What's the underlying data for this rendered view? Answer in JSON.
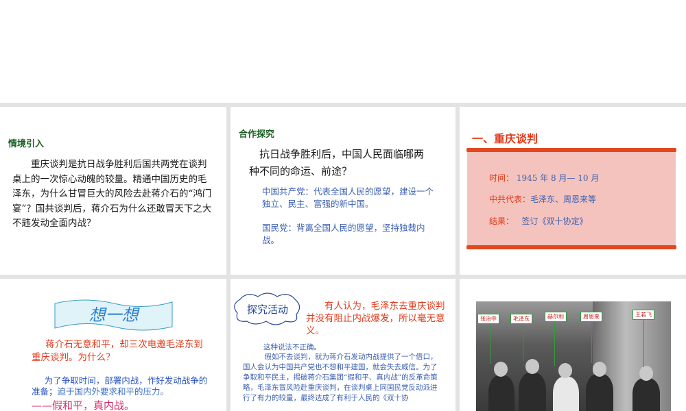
{
  "slide1": {
    "heading": "情境引入",
    "paragraph": "重庆谈判是抗日战争胜利后国共两党在谈判桌上的一次惊心动魄的较量。精通中国历史的毛泽东，为什么甘冒巨大的风险去赴蒋介石的“鸿门宴”？国共谈判后，蒋介石为什么还敢冒天下之大不韪发动全面内战？"
  },
  "slide2": {
    "heading": "合作探究",
    "question": "抗日战争胜利后，中国人民面临哪两种不同的命运、前途？",
    "answer_ccp": "中国共产党：代表全国人民的愿望，建设一个独立、民主、富强的新中国。",
    "answer_kmt": "国民党：背离全国人民的愿望，坚持独裁内战。"
  },
  "slide3": {
    "title": "一、重庆谈判",
    "time_label": "时间：",
    "time_value": "1945 年 8 月— 10 月",
    "rep_label": "中共代表：",
    "rep_value": "毛泽东、周恩来等",
    "result_label": "结果：",
    "result_value": "签订《双十协定》"
  },
  "slide4": {
    "banner": "想一想",
    "question": "蒋介石无意和平，却三次电邀毛泽东到重庆谈判。为什么？",
    "answer_blue": "为了争取时间，部署内战，作好发动战争的准备；",
    "answer_tail": "迫于国内外要求和平的压力。",
    "conclusion": "——假和平，真内战。"
  },
  "slide5": {
    "bubble": "探究活动",
    "prompt": "有人认为，毛泽东去重庆谈判并没有阻止内战爆发，所以毫无意义。",
    "answer_line1": "这种说法不正确。",
    "answer_body": "假如不去谈判，就为蒋介石发动内战提供了一个借口，国人会认为中国共产党也不想和平建国，就会失去威信。为了争取和平民主，揭破蒋介石集团“假和平、真内战”的反革命策略，毛泽东冒风险赴重庆谈判，在谈判桌上同国民党反动派进行了有力的较量，最终达成了有利于人民的《双十协"
  },
  "slide6": {
    "labels": [
      "张治中",
      "毛泽东",
      "赫尔利",
      "周恩来",
      "王若飞"
    ]
  }
}
